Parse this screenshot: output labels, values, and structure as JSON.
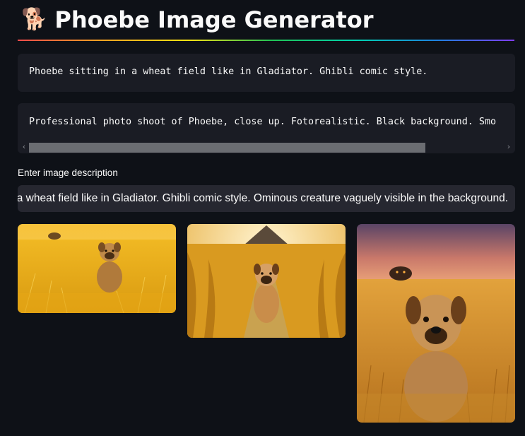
{
  "header": {
    "emoji": "🐕",
    "title": "Phoebe Image Generator"
  },
  "prompts": [
    "Phoebe sitting in a wheat field like in Gladiator. Ghibli comic style.",
    "Professional photo shoot of Phoebe, close up. Fotorealistic. Black background. Smo"
  ],
  "input": {
    "label": "Enter image description",
    "value": "n a wheat field like in Gladiator. Ghibli comic style. Ominous creature vaguely visible in the background."
  },
  "scrollbar": {
    "left_arrow": "‹",
    "right_arrow": "›"
  },
  "images": [
    {
      "subject": "dog in wheat field, wide"
    },
    {
      "subject": "dog sitting on path in wheat field"
    },
    {
      "subject": "dog close-up in wheat field with creature"
    }
  ]
}
